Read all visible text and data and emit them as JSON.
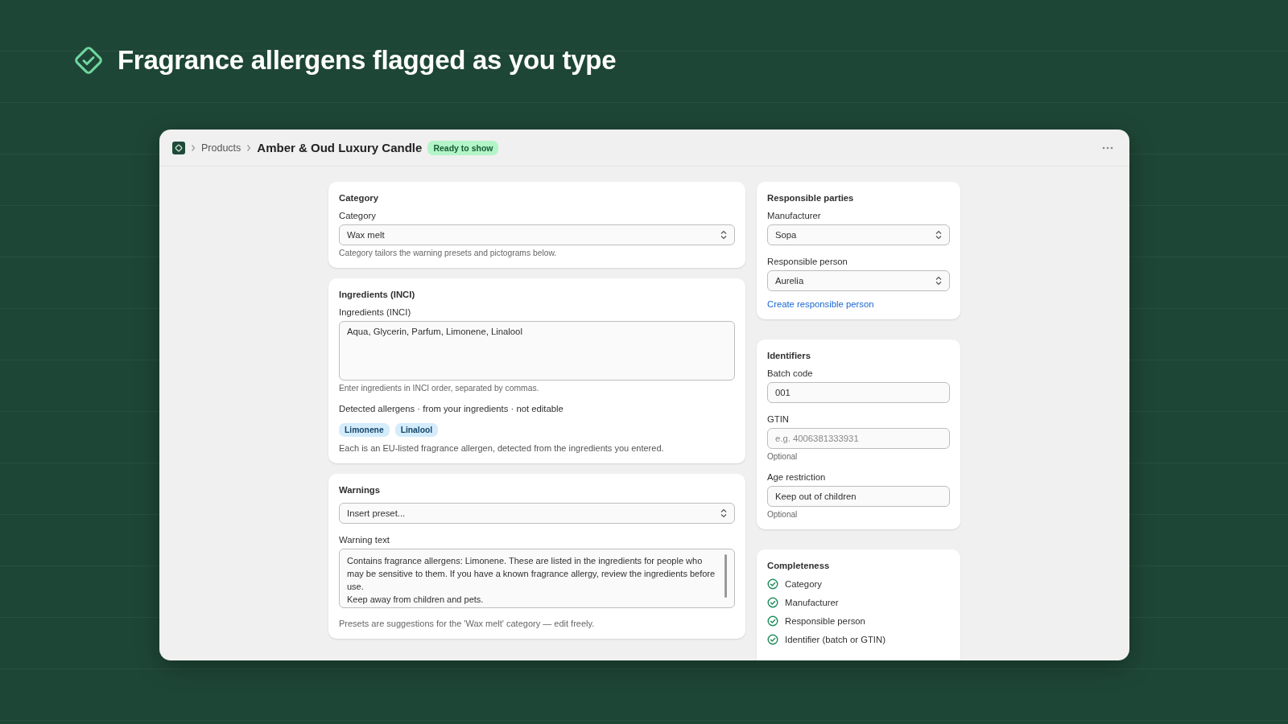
{
  "headline": "Fragrance allergens flagged as you type",
  "breadcrumb": {
    "parent": "Products",
    "title": "Amber & Oud Luxury Candle",
    "badge": "Ready to show"
  },
  "category_card": {
    "title": "Category",
    "label": "Category",
    "value": "Wax melt",
    "help": "Category tailors the warning presets and pictograms below."
  },
  "ingredients_card": {
    "title": "Ingredients (INCI)",
    "label": "Ingredients (INCI)",
    "value": "Aqua, Glycerin, Parfum, Limonene, Linalool",
    "help": "Enter ingredients in INCI order, separated by commas.",
    "allergens_label": "Detected allergens · from your ingredients · not editable",
    "allergens": [
      "Limonene",
      "Linalool"
    ],
    "allergens_note": "Each is an EU-listed fragrance allergen, detected from the ingredients you entered."
  },
  "warnings_card": {
    "title": "Warnings",
    "preset_placeholder": "Insert preset...",
    "label": "Warning text",
    "value": "Contains fragrance allergens: Limonene. These are listed in the ingredients for people who may be sensitive to them. If you have a known fragrance allergy, review the ingredients before use.\nKeep away from children and pets.",
    "help": "Presets are suggestions for the 'Wax melt' category — edit freely."
  },
  "parties_card": {
    "title": "Responsible parties",
    "fields": [
      {
        "label": "Manufacturer",
        "value": "Sopa"
      },
      {
        "label": "Responsible person",
        "value": "Aurelia"
      }
    ],
    "link": "Create responsible person"
  },
  "identifiers_card": {
    "title": "Identifiers",
    "fields": [
      {
        "label": "Batch code",
        "value": "001"
      },
      {
        "label": "GTIN",
        "placeholder": "e.g. 4006381333931",
        "hint": "Optional"
      },
      {
        "label": "Age restriction",
        "value": "Keep out of children",
        "hint": "Optional"
      }
    ]
  },
  "completeness_card": {
    "title": "Completeness",
    "items": [
      {
        "label": "Category",
        "done": true
      },
      {
        "label": "Manufacturer",
        "done": true
      },
      {
        "label": "Responsible person",
        "done": true
      },
      {
        "label": "Identifier (batch or GTIN)",
        "done": true
      }
    ]
  }
}
